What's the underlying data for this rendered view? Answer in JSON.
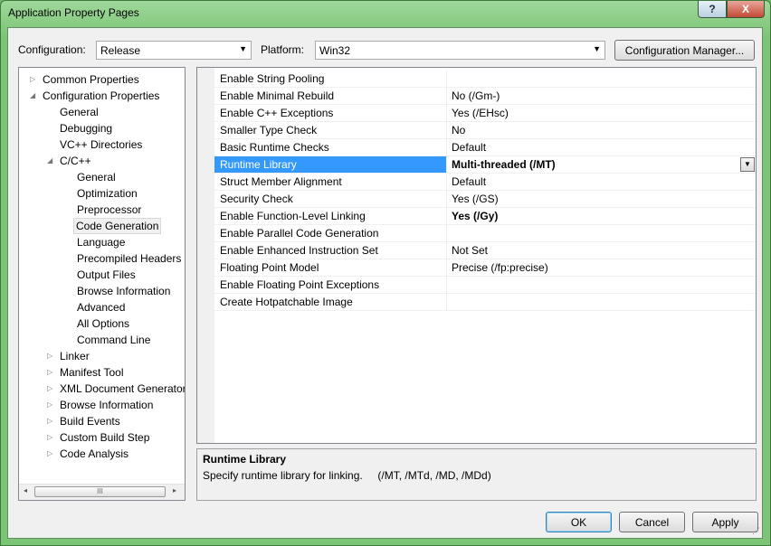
{
  "window": {
    "title": "Application Property Pages",
    "help_label": "?",
    "close_label": "X"
  },
  "config": {
    "label": "Configuration:",
    "value": "Release"
  },
  "platform": {
    "label": "Platform:",
    "value": "Win32"
  },
  "config_manager_label": "Configuration Manager...",
  "tree": {
    "nodes": [
      {
        "label": "Common Properties",
        "exp": "▷"
      },
      {
        "label": "Configuration Properties",
        "exp": "◢"
      },
      {
        "label": "General",
        "exp": ""
      },
      {
        "label": "Debugging",
        "exp": ""
      },
      {
        "label": "VC++ Directories",
        "exp": ""
      },
      {
        "label": "C/C++",
        "exp": "◢"
      },
      {
        "label": "General",
        "exp": ""
      },
      {
        "label": "Optimization",
        "exp": ""
      },
      {
        "label": "Preprocessor",
        "exp": ""
      },
      {
        "label": "Code Generation",
        "exp": ""
      },
      {
        "label": "Language",
        "exp": ""
      },
      {
        "label": "Precompiled Headers",
        "exp": ""
      },
      {
        "label": "Output Files",
        "exp": ""
      },
      {
        "label": "Browse Information",
        "exp": ""
      },
      {
        "label": "Advanced",
        "exp": ""
      },
      {
        "label": "All Options",
        "exp": ""
      },
      {
        "label": "Command Line",
        "exp": ""
      },
      {
        "label": "Linker",
        "exp": "▷"
      },
      {
        "label": "Manifest Tool",
        "exp": "▷"
      },
      {
        "label": "XML Document Generator",
        "exp": "▷"
      },
      {
        "label": "Browse Information",
        "exp": "▷"
      },
      {
        "label": "Build Events",
        "exp": "▷"
      },
      {
        "label": "Custom Build Step",
        "exp": "▷"
      },
      {
        "label": "Code Analysis",
        "exp": "▷"
      }
    ],
    "scroll_left": "◂",
    "scroll_grip": "III",
    "scroll_right": "▸"
  },
  "properties": [
    {
      "name": "Enable String Pooling",
      "value": ""
    },
    {
      "name": "Enable Minimal Rebuild",
      "value": "No (/Gm-)"
    },
    {
      "name": "Enable C++ Exceptions",
      "value": "Yes (/EHsc)"
    },
    {
      "name": "Smaller Type Check",
      "value": "No"
    },
    {
      "name": "Basic Runtime Checks",
      "value": "Default"
    },
    {
      "name": "Runtime Library",
      "value": "Multi-threaded (/MT)"
    },
    {
      "name": "Struct Member Alignment",
      "value": "Default"
    },
    {
      "name": "Security Check",
      "value": "Yes (/GS)"
    },
    {
      "name": "Enable Function-Level Linking",
      "value": "Yes (/Gy)"
    },
    {
      "name": "Enable Parallel Code Generation",
      "value": ""
    },
    {
      "name": "Enable Enhanced Instruction Set",
      "value": "Not Set"
    },
    {
      "name": "Floating Point Model",
      "value": "Precise (/fp:precise)"
    },
    {
      "name": "Enable Floating Point Exceptions",
      "value": ""
    },
    {
      "name": "Create Hotpatchable Image",
      "value": ""
    }
  ],
  "description": {
    "title": "Runtime Library",
    "text": "Specify runtime library for linking.     (/MT, /MTd, /MD, /MDd)"
  },
  "buttons": {
    "ok": "OK",
    "cancel": "Cancel",
    "apply": "Apply"
  },
  "colors": {
    "title_bar": "#8fd08a",
    "selection": "#3399ff",
    "close_button": "#c24a35"
  }
}
